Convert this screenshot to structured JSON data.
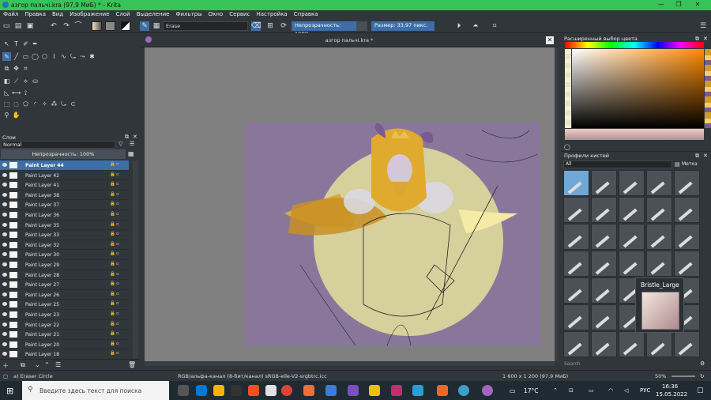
{
  "window": {
    "title": "азгор пальчі.kra (97,9 МиБ) * - Krita"
  },
  "menu": [
    "Файл",
    "Правка",
    "Вид",
    "Изображение",
    "Слой",
    "Выделение",
    "Фильтры",
    "Окно",
    "Сервис",
    "Настройка",
    "Справка"
  ],
  "toolbar": {
    "brush_preset": "Erase",
    "opacity_label": "Непрозрачность: 100%",
    "size_label": "Размер: 33,97 пикс."
  },
  "layers_panel": {
    "title": "Слои",
    "blend_mode": "Normal",
    "opacity_label": "Непрозрачность: 100%",
    "layers": [
      "Paint Layer 44",
      "Paint Layer 42",
      "Paint Layer 41",
      "Paint Layer 38",
      "Paint Layer 37",
      "Paint Layer 36",
      "Paint Layer 35",
      "Paint Layer 33",
      "Paint Layer 32",
      "Paint Layer 30",
      "Paint Layer 29",
      "Paint Layer 28",
      "Paint Layer 27",
      "Paint Layer 26",
      "Paint Layer 25",
      "Paint Layer 23",
      "Paint Layer 22",
      "Paint Layer 21",
      "Paint Layer 20",
      "Paint Layer 18"
    ]
  },
  "document": {
    "tab_title": "азгор пальчі.kra *"
  },
  "color_panel": {
    "title": "Расширенный выбор цвета"
  },
  "brush_presets": {
    "title": "Профили кистей",
    "filter": "All",
    "tag_label": "Метка",
    "tooltip": "Bristle_Large",
    "search_placeholder": "Search"
  },
  "status": {
    "tool": "a) Eraser Circle",
    "color_info": "RGB/альфа-канал (8-бит/канал)  sRGB-elle-V2-srgbtrc.icc",
    "size_info": "1 600 x 1 200 (97,9 МиБ)",
    "zoom": "50%"
  },
  "taskbar": {
    "search_text": "Введите здесь текст для поиска",
    "weather": "17°C",
    "lang": "РУС",
    "time": "16:36",
    "date": "15.05.2022"
  }
}
